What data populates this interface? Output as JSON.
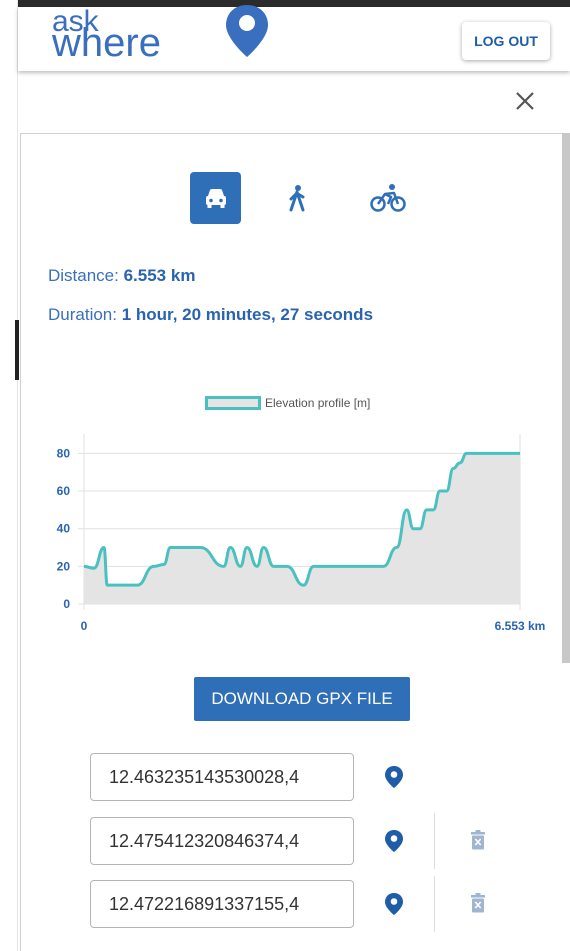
{
  "app": {
    "logo_top": "ask",
    "logo_bottom": "where"
  },
  "header": {
    "logout_label": "LOG OUT"
  },
  "panel": {
    "close_icon": "close-icon"
  },
  "modes": [
    {
      "name": "car",
      "icon": "car-icon",
      "active": true
    },
    {
      "name": "walk",
      "icon": "walk-icon",
      "active": false
    },
    {
      "name": "bike",
      "icon": "bike-icon",
      "active": false
    }
  ],
  "summary": {
    "distance_label": "Distance: ",
    "distance_value": "6.553 km",
    "duration_label": "Duration: ",
    "duration_value": "1 hour, 20 minutes, 27 seconds"
  },
  "chart_data": {
    "type": "area",
    "legend": [
      "Elevation profile [m]"
    ],
    "x_tick_labels": [
      "0",
      "6.553 km"
    ],
    "y_ticks": [
      0,
      20,
      40,
      60,
      80
    ],
    "ylim": [
      0,
      85
    ],
    "xlim": [
      0,
      6.553
    ],
    "x": [
      0,
      0.15,
      0.3,
      0.35,
      0.5,
      0.8,
      1.05,
      1.2,
      1.3,
      1.5,
      1.75,
      2.1,
      2.2,
      2.35,
      2.45,
      2.6,
      2.7,
      2.85,
      3.05,
      3.3,
      3.45,
      3.55,
      3.7,
      4.0,
      4.5,
      4.7,
      4.85,
      4.95,
      5.05,
      5.15,
      5.25,
      5.35,
      5.45,
      5.55,
      5.65,
      5.75,
      5.85,
      5.95,
      6.1,
      6.3,
      6.553
    ],
    "series": [
      {
        "name": "Elevation profile [m]",
        "values": [
          20,
          19,
          30,
          10,
          10,
          10,
          20,
          21,
          30,
          30,
          30,
          20,
          30,
          20,
          30,
          20,
          30,
          20,
          20,
          10,
          20,
          20,
          20,
          20,
          20,
          30,
          50,
          40,
          40,
          50,
          50,
          60,
          60,
          72,
          75,
          80,
          80,
          80,
          80,
          80,
          80
        ],
        "color": "#4bc0c0",
        "fill": "#e4e4e4"
      }
    ],
    "grid": true
  },
  "download": {
    "label": "DOWNLOAD GPX FILE"
  },
  "waypoints": [
    {
      "value": "12.463235143530028,4",
      "pin_icon": "location-pin-icon",
      "delete_icon": null
    },
    {
      "value": "12.475412320846374,4",
      "pin_icon": "location-pin-icon",
      "delete_icon": "trash-icon"
    },
    {
      "value": "12.472216891337155,4",
      "pin_icon": "location-pin-icon",
      "delete_icon": "trash-icon"
    }
  ],
  "colors": {
    "accent": "#2f6fb8",
    "text_accent": "#3a6fbf",
    "line": "#4bc0c0"
  }
}
